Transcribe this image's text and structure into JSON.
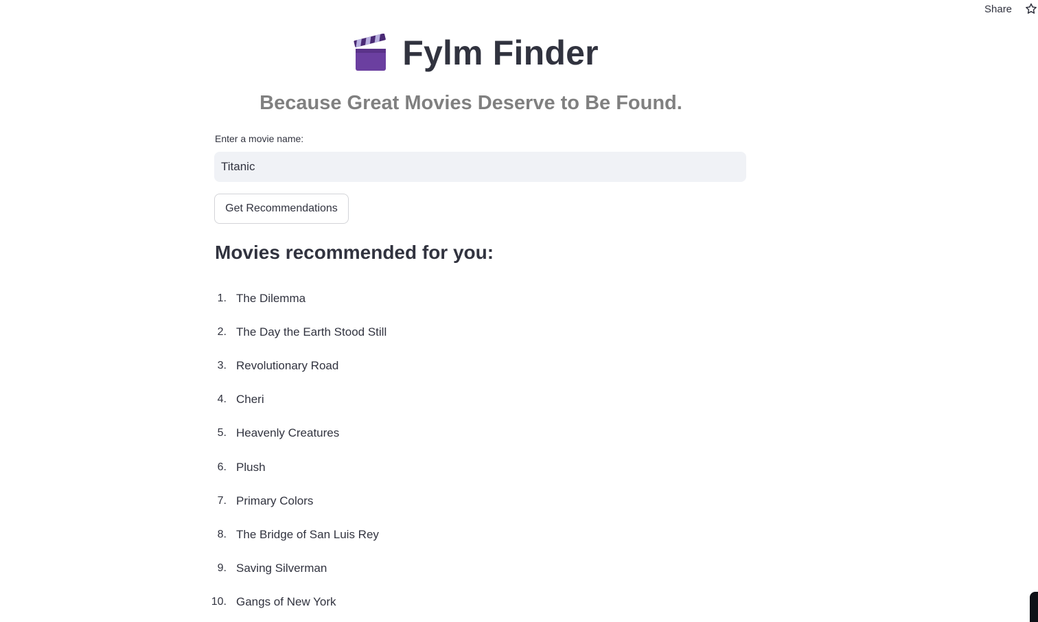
{
  "header": {
    "share_label": "Share",
    "star_icon": "star-outline-icon"
  },
  "app": {
    "icon": "clapper-board-icon",
    "title": "Fylm Finder",
    "subtitle": "Because Great Movies Deserve to Be Found."
  },
  "search": {
    "label": "Enter a movie name:",
    "value": "Titanic",
    "placeholder": ""
  },
  "button": {
    "label": "Get Recommendations"
  },
  "results": {
    "heading": "Movies recommended for you:",
    "items": [
      {
        "num": "1.",
        "title": "The Dilemma"
      },
      {
        "num": "2.",
        "title": "The Day the Earth Stood Still"
      },
      {
        "num": "3.",
        "title": "Revolutionary Road"
      },
      {
        "num": "4.",
        "title": "Cheri"
      },
      {
        "num": "5.",
        "title": "Heavenly Creatures"
      },
      {
        "num": "6.",
        "title": "Plush"
      },
      {
        "num": "7.",
        "title": "Primary Colors"
      },
      {
        "num": "8.",
        "title": "The Bridge of San Luis Rey"
      },
      {
        "num": "9.",
        "title": "Saving Silverman"
      },
      {
        "num": "10.",
        "title": "Gangs of New York"
      }
    ]
  },
  "colors": {
    "text": "#31333f",
    "subtitle": "#808080",
    "input_bg": "#f0f2f6",
    "clapper_body": "#6b3fa0",
    "clapper_stripe": "#b8b0e0"
  }
}
